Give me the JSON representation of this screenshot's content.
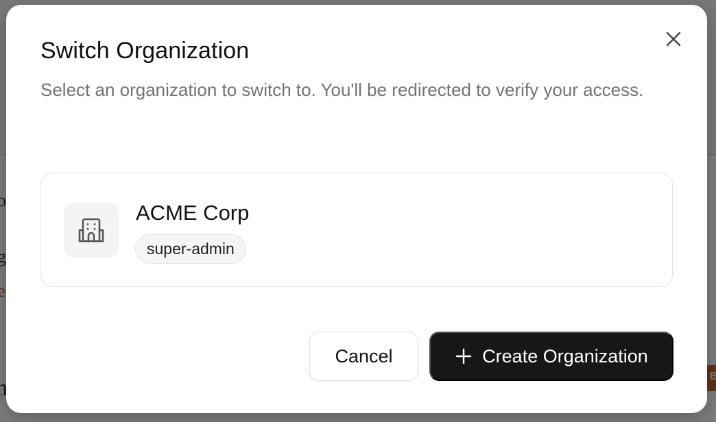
{
  "dialog": {
    "title": "Switch Organization",
    "description": "Select an organization to switch to. You'll be redirected to verify your access."
  },
  "organizations": [
    {
      "name": "ACME Corp",
      "role": "super-admin",
      "icon": "building-icon"
    }
  ],
  "actions": {
    "cancel_label": "Cancel",
    "create_label": "Create Organization"
  },
  "background": {
    "badge": "B"
  },
  "colors": {
    "primary_button": "#171717",
    "muted_text": "#737373",
    "border": "#e2e2e2"
  }
}
